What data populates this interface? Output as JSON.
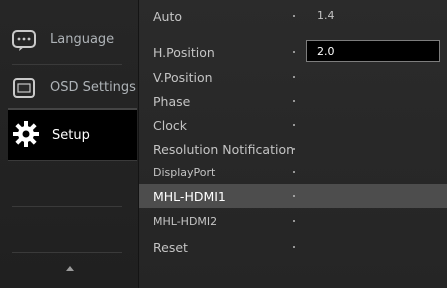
{
  "nav": {
    "items": [
      {
        "label": "Language",
        "icon": "language-icon"
      },
      {
        "label": "OSD Settings",
        "icon": "osd-settings-icon"
      },
      {
        "label": "Setup",
        "icon": "setup-gear-icon",
        "active": true
      }
    ]
  },
  "menu": {
    "items": [
      {
        "label": "Auto",
        "value": "1.4"
      },
      {
        "label": "H.Position",
        "value": ""
      },
      {
        "label": "V.Position",
        "value": ""
      },
      {
        "label": "Phase",
        "value": ""
      },
      {
        "label": "Clock",
        "value": ""
      },
      {
        "label": "Resolution Notification",
        "value": ""
      },
      {
        "label": "DisplayPort",
        "value": ""
      },
      {
        "label": "MHL-HDMI1",
        "value": "",
        "selected": true
      },
      {
        "label": "MHL-HDMI2",
        "value": ""
      },
      {
        "label": "Reset",
        "value": ""
      }
    ],
    "value_box": "2.0"
  },
  "colors": {
    "background": "#2a2a2a",
    "active_nav_bg": "#000000",
    "selected_row_bg": "#4d4d4d",
    "text": "#c4c4c4"
  }
}
